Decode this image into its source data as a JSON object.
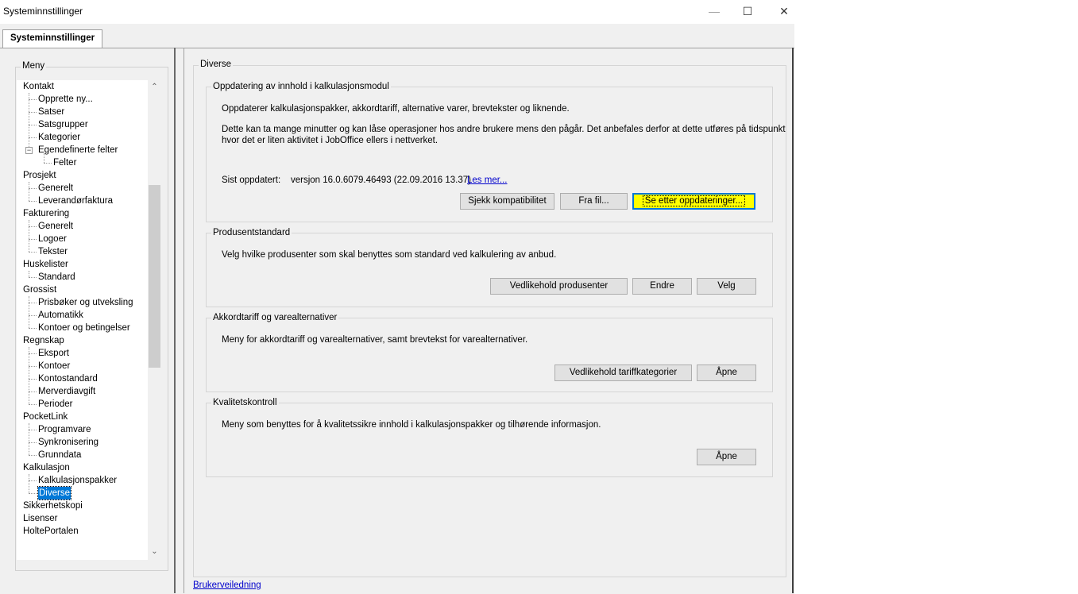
{
  "window": {
    "title": "Systeminnstillinger",
    "minimize_glyph": "—",
    "maximize_glyph": "☐",
    "close_glyph": "✕"
  },
  "tab": {
    "label": "Systeminnstillinger"
  },
  "menu": {
    "label": "Meny",
    "items": [
      {
        "label": "Kontakt"
      },
      {
        "label": "Opprette ny..."
      },
      {
        "label": "Satser"
      },
      {
        "label": "Satsgrupper"
      },
      {
        "label": "Kategorier"
      },
      {
        "label": "Egendefinerte felter"
      },
      {
        "label": "Felter"
      },
      {
        "label": "Prosjekt"
      },
      {
        "label": "Generelt"
      },
      {
        "label": "Leverandørfaktura"
      },
      {
        "label": "Fakturering"
      },
      {
        "label": "Generelt"
      },
      {
        "label": "Logoer"
      },
      {
        "label": "Tekster"
      },
      {
        "label": "Huskelister"
      },
      {
        "label": "Standard"
      },
      {
        "label": "Grossist"
      },
      {
        "label": "Prisbøker og utveksling"
      },
      {
        "label": "Automatikk"
      },
      {
        "label": "Kontoer og betingelser"
      },
      {
        "label": "Regnskap"
      },
      {
        "label": "Eksport"
      },
      {
        "label": "Kontoer"
      },
      {
        "label": "Kontostandard"
      },
      {
        "label": "Merverdiavgift"
      },
      {
        "label": "Perioder"
      },
      {
        "label": "PocketLink"
      },
      {
        "label": "Programvare"
      },
      {
        "label": "Synkronisering"
      },
      {
        "label": "Grunndata"
      },
      {
        "label": "Kalkulasjon"
      },
      {
        "label": "Kalkulasjonspakker"
      },
      {
        "label": "Diverse"
      },
      {
        "label": "Sikkerhetskopi"
      },
      {
        "label": "Lisenser"
      },
      {
        "label": "HoltePortalen"
      }
    ],
    "selected_label": "Diverse",
    "expander_glyph": "−",
    "scroll_up_glyph": "⌃",
    "scroll_down_glyph": "⌄"
  },
  "main": {
    "title": "Diverse",
    "update": {
      "title": "Oppdatering av innhold i kalkulasjonsmodul",
      "desc1": "Oppdaterer kalkulasjonspakker, akkordtariff, alternative varer, brevtekster og liknende.",
      "desc2_line1": "Dette kan ta mange minutter og kan låse operasjoner hos andre brukere mens den pågår. Det anbefales derfor at dette utføres på tidspunkt",
      "desc2_line2": "hvor det er liten aktivitet i JobOffice ellers i nettverket.",
      "last_updated_label": "Sist oppdatert:",
      "last_updated_value": "versjon 16.0.6079.46493 (22.09.2016 13.37)",
      "read_more": "Les mer...",
      "btn_check": "Sjekk kompatibilitet",
      "btn_file": "Fra fil...",
      "btn_search": "Se etter oppdateringer..."
    },
    "producer": {
      "title": "Produsentstandard",
      "desc": "Velg hvilke produsenter som skal benyttes som standard ved kalkulering av anbud.",
      "btn_maintain": "Vedlikehold produsenter",
      "btn_change": "Endre",
      "btn_choose": "Velg"
    },
    "tariff": {
      "title": "Akkordtariff og varealternativer",
      "desc": "Meny for akkordtariff og varealternativer, samt brevtekst for varealternativer.",
      "btn_maintain": "Vedlikehold tariffkategorier",
      "btn_open": "Åpne"
    },
    "quality": {
      "title": "Kvalitetskontroll",
      "desc": "Meny som benyttes for å kvalitetssikre innhold i kalkulasjonspakker og tilhørende informasjon.",
      "btn_open": "Åpne"
    },
    "user_guide": "Brukerveiledning"
  },
  "colors": {
    "selection": "#0078d7",
    "primary_button": "#ffff00",
    "link": "#0000cc"
  }
}
